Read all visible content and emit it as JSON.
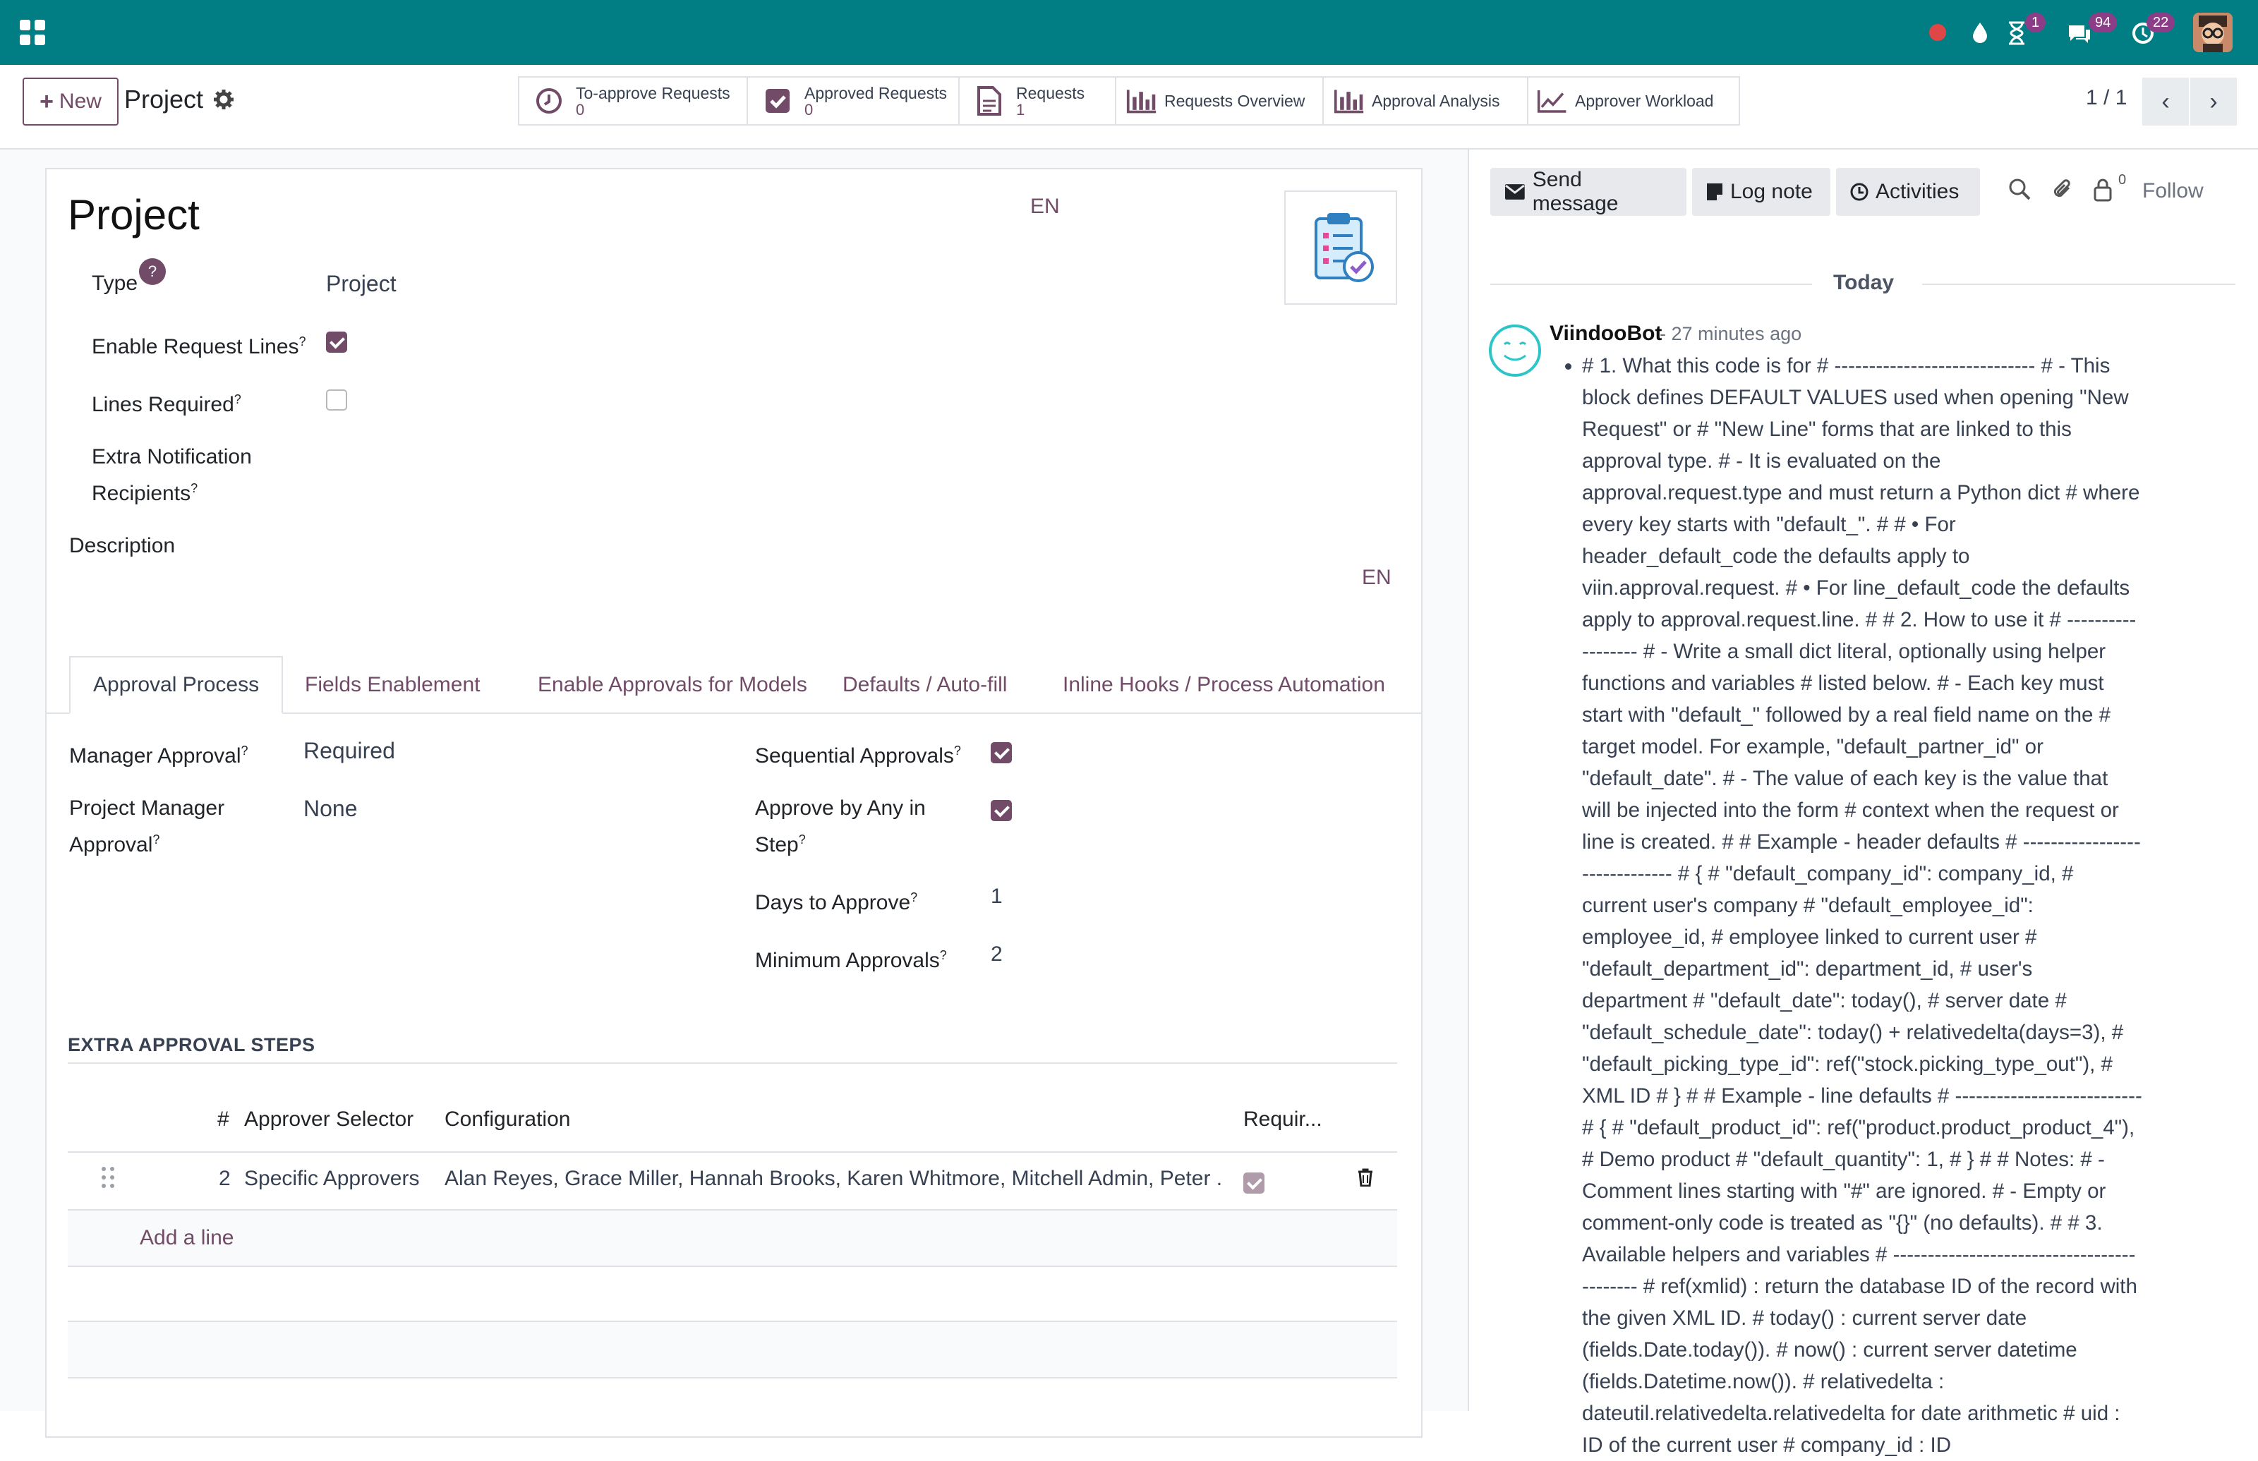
{
  "topbar": {
    "activity_count": "1",
    "messages_count": "94",
    "updates_count": "22"
  },
  "control_panel": {
    "new_label": "New",
    "breadcrumb": "Project",
    "smart_buttons": [
      {
        "title": "To-approve Requests",
        "value": "0"
      },
      {
        "title": "Approved Requests",
        "value": "0"
      },
      {
        "title": "Requests",
        "value": "1"
      },
      {
        "title": "Requests Overview",
        "value": ""
      },
      {
        "title": "Approval Analysis",
        "value": ""
      },
      {
        "title": "Approver Workload",
        "value": ""
      }
    ],
    "pager": "1 / 1"
  },
  "form": {
    "title": "Project",
    "lang_title": "EN",
    "lang_description": "EN",
    "fields": {
      "type_label": "Type",
      "type_value": "Project",
      "help_mark": "?",
      "enable_request_lines_label": "Enable Request Lines",
      "enable_request_lines": true,
      "lines_required_label": "Lines Required",
      "lines_required": false,
      "extra_notification_label_1": "Extra Notification",
      "extra_notification_label_2": "Recipients",
      "description_label": "Description",
      "sup": "?"
    },
    "tabs": [
      "Approval Process",
      "Fields Enablement",
      "Enable Approvals for Models",
      "Defaults / Auto-fill",
      "Inline Hooks / Process Automation"
    ],
    "approval": {
      "manager_approval_label": "Manager Approval",
      "manager_approval_value": "Required",
      "project_manager_label_1": "Project Manager",
      "project_manager_label_2": "Approval",
      "project_manager_value": "None",
      "sequential_label": "Sequential Approvals",
      "sequential": true,
      "approve_any_label_1": "Approve by Any in",
      "approve_any_label_2": "Step",
      "approve_any": true,
      "days_label": "Days to Approve",
      "days_value": "1",
      "min_label": "Minimum Approvals",
      "min_value": "2"
    },
    "steps": {
      "title": "EXTRA APPROVAL STEPS",
      "headers": [
        "#",
        "Approver Selector",
        "Configuration",
        "Requir..."
      ],
      "rows": [
        {
          "seq": "2",
          "selector": "Specific Approvers",
          "configuration": "Alan Reyes, Grace Miller, Hannah Brooks, Karen Whitmore, Mitchell Admin, Peter ...",
          "required": true
        }
      ],
      "add_line": "Add a line"
    }
  },
  "chatter": {
    "send_message": "Send message",
    "log_note": "Log note",
    "activities": "Activities",
    "followers_count": "0",
    "follow": "Follow",
    "date_separator": "Today",
    "message": {
      "author": "ViindooBot",
      "time": "- 27 minutes ago",
      "body": "# 1. What this code is for # ----------------------------- # - This block defines DEFAULT VALUES used when opening \"New Request\" or # \"New Line\" forms that are linked to this approval type. # - It is evaluated on the approval.request.type and must return a Python dict # where every key starts with \"default_\". # # • For header_default_code the defaults apply to viin.approval.request. # • For line_default_code the defaults apply to approval.request.line. # # 2. How to use it # ------------------ # - Write a small dict literal, optionally using helper functions and variables # listed below. # - Each key must start with \"default_\" followed by a real field name on the # target model. For example, \"default_partner_id\" or \"default_date\". # - The value of each key is the value that will be injected into the form # context when the request or line is created. # # Example - header defaults # ------------------------------ # { # \"default_company_id\": company_id, # current user's company # \"default_employee_id\": employee_id, # employee linked to current user # \"default_department_id\": department_id, # user's department # \"default_date\": today(), # server date # \"default_schedule_date\": today() + relativedelta(days=3), # \"default_picking_type_id\": ref(\"stock.picking_type_out\"), # XML ID # } # # Example - line defaults # --------------------------- # { # \"default_product_id\": ref(\"product.product_product_4\"), # Demo product # \"default_quantity\": 1, # } # # Notes: # - Comment lines starting with \"#\" are ignored. # - Empty or comment-only code is treated as \"{}\" (no defaults). # # 3. Available helpers and variables # ------------------------------------------- # ref(xmlid) : return the database ID of the record with the given XML ID. # today() : current server date (fields.Date.today()). # now() : current server datetime (fields.Datetime.now()). # relativedelta : dateutil.relativedelta.relativedelta for date arithmetic # uid : ID of the current user # company_id : ID"
    }
  },
  "colors": {
    "brand": "#017e84",
    "accent": "#714b67",
    "badge": "#8b3e87"
  }
}
